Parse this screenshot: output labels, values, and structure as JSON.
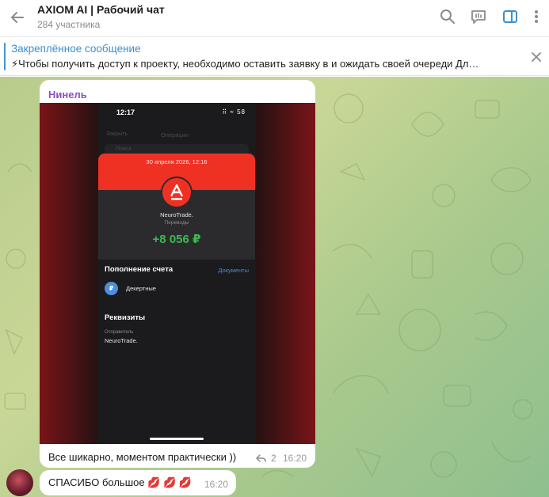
{
  "header": {
    "title": "AXIOM AI | Рабочий чат",
    "subtitle": "284 участника",
    "icons": [
      "back-arrow-icon",
      "search-icon",
      "live-chat-icon",
      "sidebar-toggle-icon",
      "more-vertical-icon"
    ]
  },
  "pinned": {
    "title": "Закреплённое сообщение",
    "text": "⚡Чтобы получить доступ к проекту, необходимо оставить заявку в  и ожидать своей очереди  Дл…"
  },
  "messages": [
    {
      "sender": "Нинель",
      "caption": "Все шикарно, моментом практически ))",
      "replies": "2",
      "time": "16:20",
      "screenshot": {
        "status_time": "12:17",
        "status_icons": "⠿ ≈ 58",
        "close_label": "Закрыть",
        "title": "Операции",
        "search_placeholder": "Поиск",
        "date": "30 апреля 2026, 12:16",
        "logo_letter": "А",
        "merchant": "NeuroTrade.",
        "category": "Переводы",
        "amount": "+8 056 ₽",
        "topup_title": "Пополнение счета",
        "documents_link": "Документы",
        "account_icon_letter": "₽",
        "account_name": "Декертные",
        "requisites_title": "Реквизиты",
        "sender_label": "Отправитель",
        "sender_value": "NeuroTrade."
      }
    },
    {
      "text": "СПАСИБО большое 💋 💋 💋",
      "time": "16:20"
    }
  ],
  "colors": {
    "accent": "#3a8fd0",
    "sender_name": "#8d4fc4",
    "bank_red": "#ef3124",
    "amount_green": "#3fb950"
  }
}
